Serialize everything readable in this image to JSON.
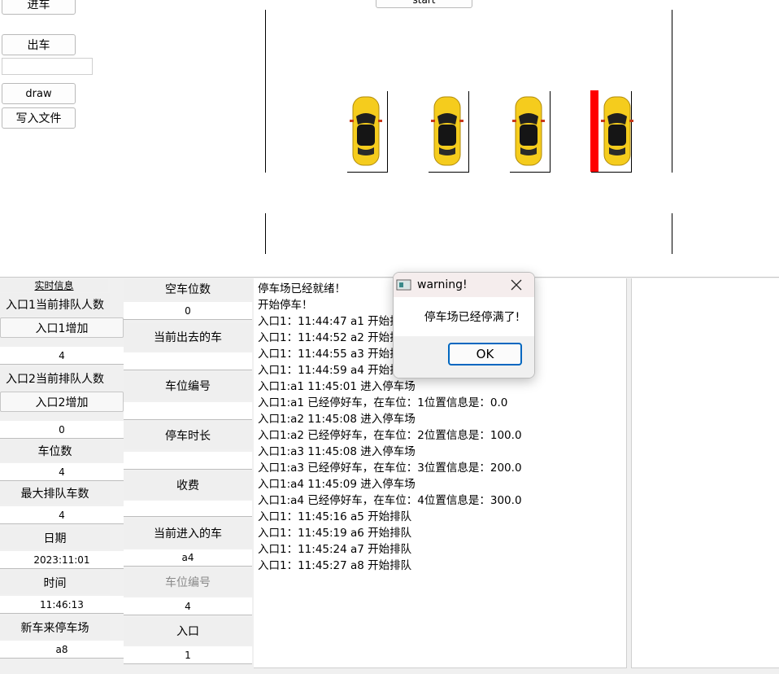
{
  "controls": {
    "enter_label": "进车",
    "exit_label": "出车",
    "exit_input_value": "",
    "draw_label": "draw",
    "write_file_label": "写入文件",
    "start_label": "start"
  },
  "colors": {
    "car_body": "#f5cc1d",
    "occupied_marker": "#ff0000",
    "ok_border": "#0067c0"
  },
  "info": {
    "header": "实时信息",
    "entrance1_queue_label": "入口1当前排队人数",
    "entrance1_add_label": "入口1增加",
    "entrance1_queue_value": "4",
    "entrance2_queue_label": "入口2当前排队人数",
    "entrance2_add_label": "入口2增加",
    "entrance2_queue_value": "0",
    "spaces_label": "车位数",
    "spaces_value": "4",
    "max_queue_label": "最大排队车数",
    "max_queue_value": "4",
    "date_label": "日期",
    "date_value": "2023:11:01",
    "time_label": "时间",
    "time_value": "11:46:13",
    "new_car_label": "新车来停车场",
    "new_car_value": "a8"
  },
  "details": {
    "free_spaces_label": "空车位数",
    "free_spaces_value": "0",
    "current_exit_label": "当前出去的车",
    "current_exit_value": "",
    "space_no_label": "车位编号",
    "space_no_value": "",
    "duration_label": "停车时长",
    "duration_value": "",
    "fee_label": "收费",
    "fee_value": "",
    "current_enter_label": "当前进入的车",
    "current_enter_value": "a4",
    "space_no2_label": "车位编号",
    "space_no2_value": "4",
    "entrance_label": "入口",
    "entrance_value": "1"
  },
  "log": [
    "停车场已经就绪！",
    "开始停车！",
    "入口1：11:44:47 a1 开始排队",
    "入口1：11:44:52 a2 开始排队",
    "入口1：11:44:55 a3 开始排队",
    "入口1：11:44:59 a4 开始排队",
    "入口1:a1 11:45:01 进入停车场",
    "入口1:a1 已经停好车，在车位：1位置信息是：0.0",
    "入口1:a2 11:45:08 进入停车场",
    "入口1:a2 已经停好车，在车位：2位置信息是：100.0",
    "入口1:a3 11:45:08 进入停车场",
    "入口1:a3 已经停好车，在车位：3位置信息是：200.0",
    "入口1:a4 11:45:09 进入停车场",
    "入口1:a4 已经停好车，在车位：4位置信息是：300.0",
    "入口1：11:45:16 a5 开始排队",
    "入口1：11:45:19 a6 开始排队",
    "入口1：11:45:24 a7 开始排队",
    "入口1：11:45:27 a8 开始排队"
  ],
  "dialog": {
    "title": "warning!",
    "message": "停车场已经停满了!",
    "ok_label": "OK"
  }
}
